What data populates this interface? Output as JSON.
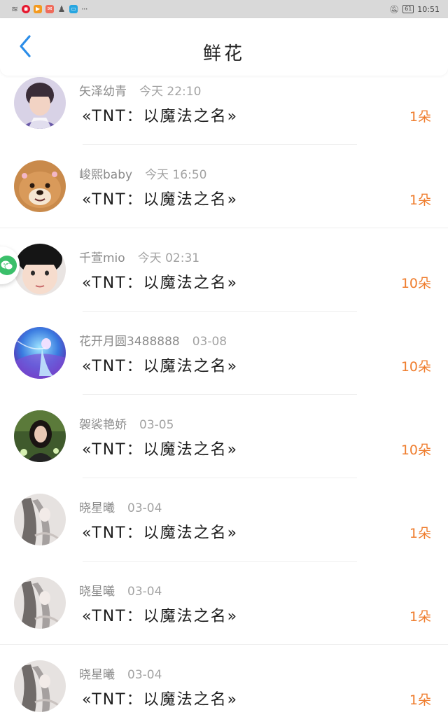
{
  "status_bar": {
    "time": "10:51",
    "battery": "61",
    "overflow": "···",
    "icons": [
      "wifi-icon",
      "weibo-icon",
      "video-icon",
      "mail-icon",
      "qq-icon",
      "tv-icon"
    ],
    "right_icons": [
      "bell-off-icon",
      "battery-icon"
    ]
  },
  "header": {
    "title": "鲜花",
    "back_icon": "chevron-left-icon",
    "accent_color": "#2b8de8"
  },
  "list": {
    "count_color": "#ef7d2e",
    "items": [
      {
        "name": "矢泽幼青",
        "time": "今天 22:10",
        "gift": "«TNT：以魔法之名»",
        "count": "1朵",
        "avatar": "avatar-boy-purple"
      },
      {
        "name": "峻熙baby",
        "time": "今天 16:50",
        "gift": "«TNT：以魔法之名»",
        "count": "1朵",
        "avatar": "avatar-shiba-dog"
      },
      {
        "name": "千萱mio",
        "time": "今天 02:31",
        "gift": "«TNT：以魔法之名»",
        "count": "10朵",
        "avatar": "avatar-boy-closeup"
      },
      {
        "name": "花开月圆3488888",
        "time": "03-08",
        "gift": "«TNT：以魔法之名»",
        "count": "10朵",
        "avatar": "avatar-blue-fantasy"
      },
      {
        "name": "袈裟艳娇",
        "time": "03-05",
        "gift": "«TNT：以魔法之名»",
        "count": "10朵",
        "avatar": "avatar-girl-green"
      },
      {
        "name": "晓星曦",
        "time": "03-04",
        "gift": "«TNT：以魔法之名»",
        "count": "1朵",
        "avatar": "avatar-ink-painting"
      },
      {
        "name": "晓星曦",
        "time": "03-04",
        "gift": "«TNT：以魔法之名»",
        "count": "1朵",
        "avatar": "avatar-ink-painting"
      },
      {
        "name": "晓星曦",
        "time": "03-04",
        "gift": "«TNT：以魔法之名»",
        "count": "1朵",
        "avatar": "avatar-ink-painting"
      }
    ]
  },
  "floating_button": {
    "icon": "wechat-share-icon"
  }
}
